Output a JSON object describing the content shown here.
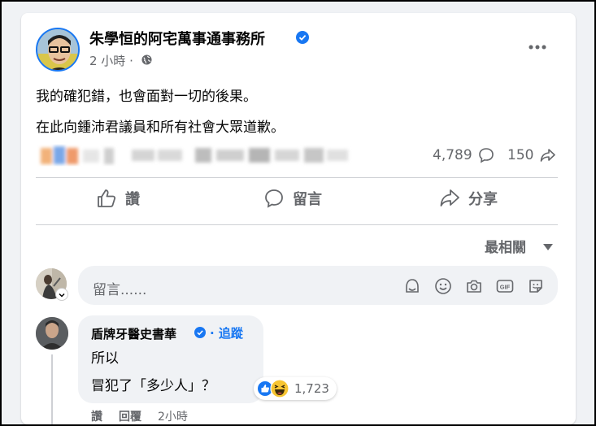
{
  "post": {
    "page_name": "朱學恒的阿宅萬事通事務所",
    "time": "2 小時 ·",
    "text_line1": "我的確犯錯，也會面對一切的後果。",
    "text_line2": "在此向鍾沛君議員和所有社會大眾道歉。",
    "comments_count": "4,789",
    "shares_count": "150"
  },
  "actions": {
    "like_label": "讚",
    "comment_label": "留言",
    "share_label": "分享"
  },
  "sort": {
    "label": "最相關"
  },
  "composer": {
    "placeholder": "留言......"
  },
  "comment": {
    "author": "盾牌牙醫史書華",
    "follow_label": "· 追蹤",
    "line1": "所以",
    "line2": "冒犯了「多少人」？",
    "reaction_count": "1,723",
    "like_action": "讚",
    "reply_action": "回覆",
    "time": "2小時"
  },
  "colors": {
    "accent": "#1877f2",
    "secondary_text": "#65676b",
    "background": "#f0f2f5"
  },
  "icons": {
    "verified": "verified-badge-icon",
    "globe": "globe-icon",
    "more": "more-options-icon",
    "like": "thumbs-up-icon",
    "comment": "speech-bubble-icon",
    "share": "share-arrow-icon",
    "sticker_avatar": "avatar-sticker-icon",
    "emoji": "emoji-icon",
    "camera": "camera-icon",
    "gif": "gif-icon",
    "sticker": "sticker-icon"
  }
}
